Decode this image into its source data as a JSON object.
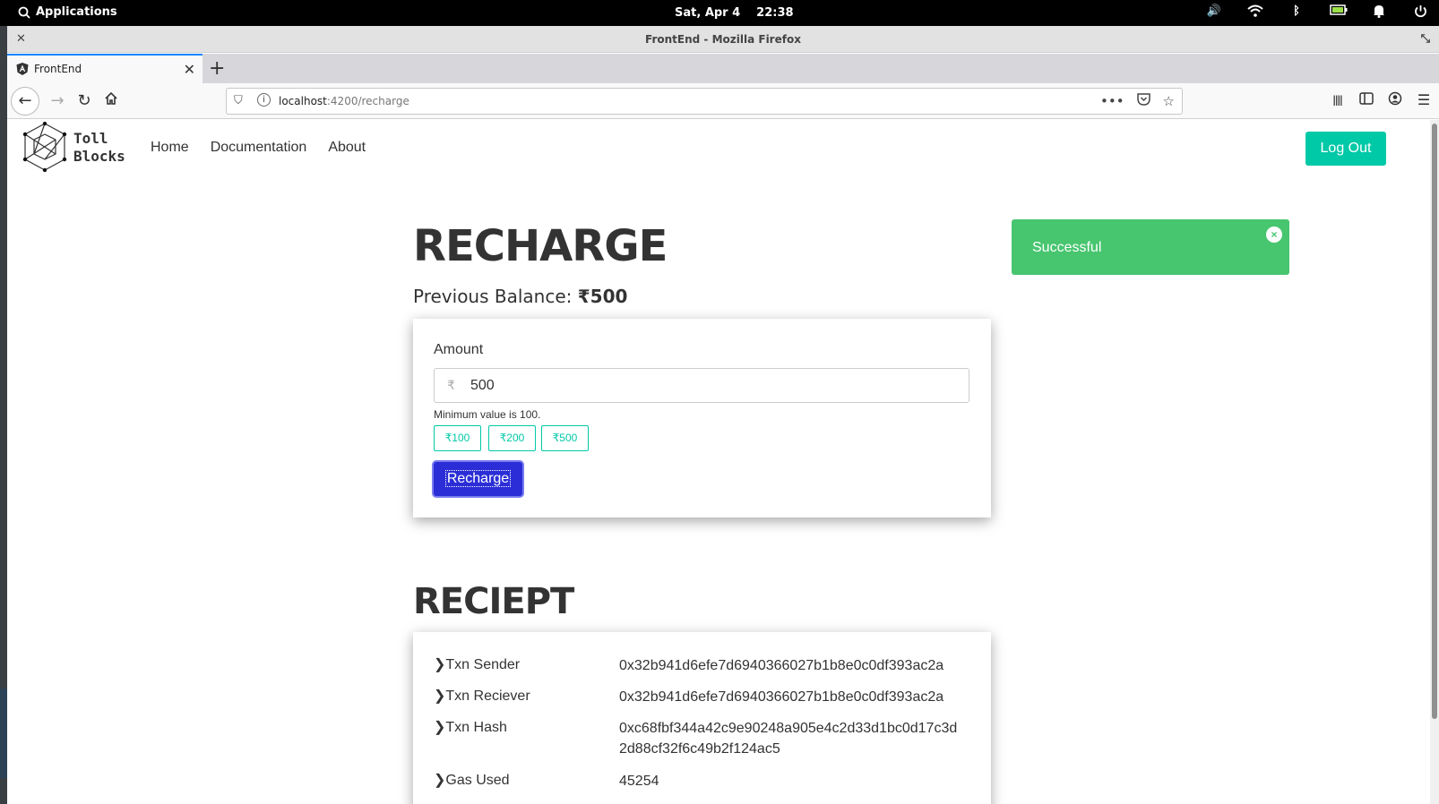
{
  "os": {
    "applications": "Applications",
    "date": "Sat, Apr 4",
    "time": "22:38"
  },
  "window": {
    "title": "FrontEnd - Mozilla Firefox"
  },
  "browser": {
    "tab_label": "FrontEnd",
    "url_host": "localhost",
    "url_path": ":4200/recharge"
  },
  "site": {
    "brand_line1": "Toll",
    "brand_line2": "Blocks",
    "menu": [
      {
        "label": "Home"
      },
      {
        "label": "Documentation"
      },
      {
        "label": "About"
      }
    ],
    "logout_label": "Log Out"
  },
  "recharge": {
    "heading": "RECHARGE",
    "prev_balance_label": "Previous Balance:",
    "prev_balance_value": "₹500",
    "amount_label": "Amount",
    "currency_symbol": "₹",
    "amount_value": "500",
    "hint": "Minimum value is 100.",
    "chips": [
      "₹100",
      "₹200",
      "₹500"
    ],
    "button_label": "Recharge"
  },
  "toast": {
    "message": "Successful",
    "close": "×"
  },
  "receipt": {
    "heading": "RECIEPT",
    "rows": [
      {
        "key": "Txn Sender",
        "value": "0x32b941d6efe7d6940366027b1b8e0c0df393ac2a"
      },
      {
        "key": "Txn Reciever",
        "value": "0x32b941d6efe7d6940366027b1b8e0c0df393ac2a"
      },
      {
        "key": "Txn Hash",
        "value": "0xc68fbf344a42c9e90248a905e4c2d33d1bc0d17c3d2d88cf32f6c49b2f124ac5"
      },
      {
        "key": "Gas Used",
        "value": "45254"
      }
    ]
  },
  "colors": {
    "accent": "#00c9a7",
    "primary_button": "#2b2ed6",
    "toast_success": "#47c56f"
  }
}
